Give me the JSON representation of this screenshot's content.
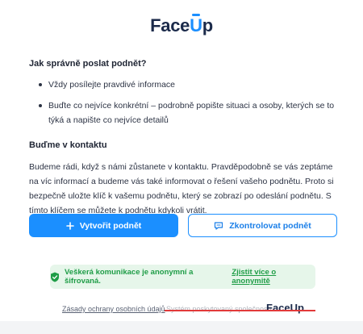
{
  "header": {
    "logo_text_a": "Face",
    "logo_text_u": "U",
    "logo_text_b": "p"
  },
  "section1": {
    "heading": "Jak správně poslat podnět?",
    "items": [
      "Vždy posílejte pravdivé informace",
      "Buďte co nejvíce konkrétní – podrobně popište situaci a osoby, kterých se to týká a napište co nejvíce detailů"
    ]
  },
  "section2": {
    "heading": "Buďme v kontaktu",
    "paragraph": "Budeme rádi, když s námi zůstanete v kontaktu. Pravděpodobně se vás zeptáme na víc informací a budeme vás také informovat o řešení vašeho podnětu. Proto si bezpečně uložte klíč k vašemu podnětu, který se zobrazí po odeslání podnětu. S tímto klíčem se můžete k podnětu kdykoli vrátit."
  },
  "buttons": {
    "create_label": "Vytvořit podnět",
    "check_label": "Zkontrolovat podnět"
  },
  "notice": {
    "text": "Veškerá komunikace je anonymní a šifrovaná.",
    "link": "Zjistit více o anonymitě"
  },
  "footer": {
    "privacy_link": "Zásady ochrany osobních údajů",
    "powered_by": "Systém poskytovaný společností",
    "logo_text": "FaceUp"
  },
  "colors": {
    "brand": "#1b8fff",
    "success": "#1f9d47",
    "strike": "#e23a3a"
  }
}
